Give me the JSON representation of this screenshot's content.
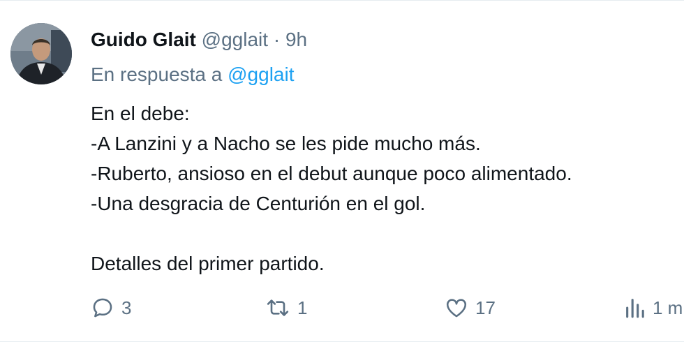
{
  "tweet": {
    "author_name": "Guido Glait",
    "author_handle": "@gglait",
    "separator": "·",
    "time": "9h",
    "reply_prefix": "En respuesta a",
    "reply_handle": "@gglait",
    "lines": [
      "En el debe:",
      "-A Lanzini y a Nacho se les pide mucho más.",
      "-Ruberto, ansioso en el debut aunque poco alimentado.",
      "-Una desgracia de Centurión en el gol.",
      "",
      "Detalles del primer partido."
    ]
  },
  "actions": {
    "reply": {
      "icon": "reply-icon",
      "count": "3"
    },
    "retweet": {
      "icon": "retweet-icon",
      "count": "1"
    },
    "like": {
      "icon": "like-icon",
      "count": "17"
    },
    "stats": {
      "icon": "stats-icon",
      "count": "1 m"
    }
  },
  "colors": {
    "text": "#0f1419",
    "secondary": "#5b7083",
    "link": "#1da1f2",
    "border": "#e6ecf0"
  }
}
